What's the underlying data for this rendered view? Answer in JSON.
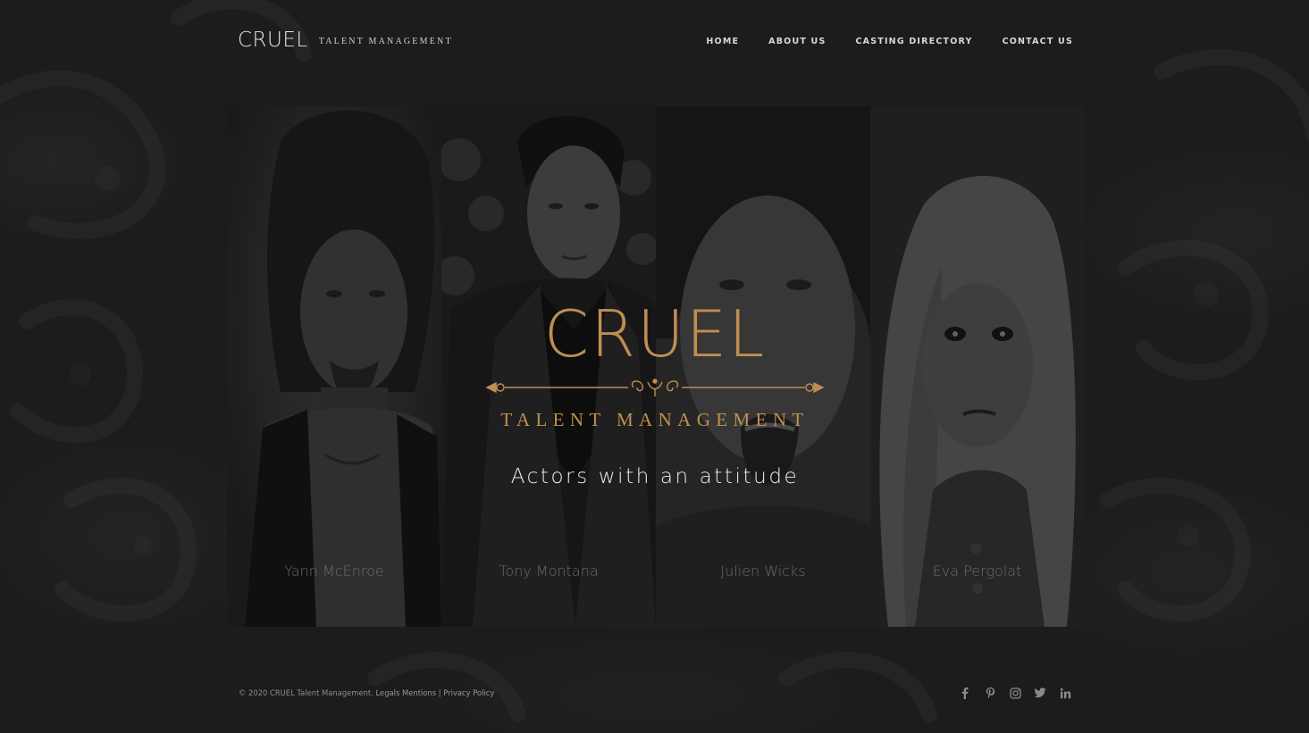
{
  "header": {
    "logo_main": "CRUEL",
    "logo_sub": "TALENT MANAGEMENT",
    "nav": [
      {
        "label": "HOME"
      },
      {
        "label": "ABOUT US"
      },
      {
        "label": "CASTING DIRECTORY"
      },
      {
        "label": "CONTACT US"
      }
    ]
  },
  "hero": {
    "title": "CRUEL",
    "subtitle": "TALENT MANAGEMENT",
    "tagline": "Actors with an attitude",
    "accent_color": "#bf8f52",
    "actors": [
      {
        "name": "Yann McEnroe"
      },
      {
        "name": "Tony Montana"
      },
      {
        "name": "Julien Wicks"
      },
      {
        "name": "Eva Pergolat"
      }
    ]
  },
  "footer": {
    "copyright": "© 2020 CRUEL Talent Management.",
    "legal_link": "Legals Mentions",
    "separator": "|",
    "privacy_link": "Privacy Policy",
    "social_icons": [
      "facebook-icon",
      "pinterest-icon",
      "instagram-icon",
      "twitter-icon",
      "linkedin-icon"
    ]
  }
}
